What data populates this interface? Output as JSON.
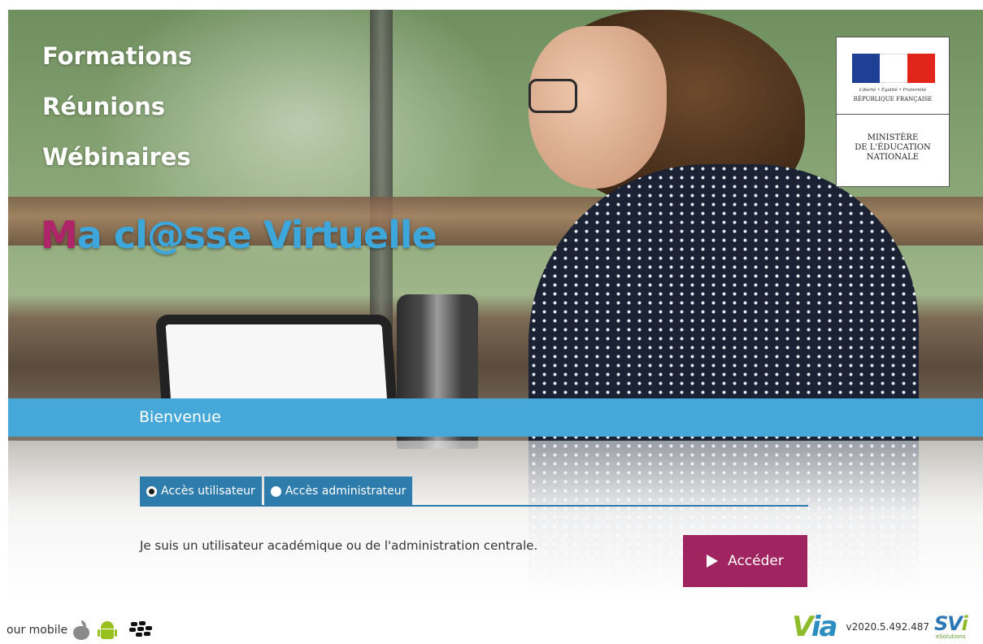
{
  "hero": {
    "taglines": [
      "Formations",
      "Réunions",
      "Wébinaires"
    ],
    "brand": {
      "part_m": "M",
      "part_rest": "a cl@sse Virtuelle",
      "color_m": "#b0246a",
      "color_rest": "#3da7db"
    },
    "ministry": {
      "motto": "Liberté • Égalité • Fraternité",
      "republic": "RÉPUBLIQUE FRANÇAISE",
      "line1": "MINISTÈRE",
      "line2": "DE L'ÉDUCATION",
      "line3": "NATIONALE"
    }
  },
  "welcome": {
    "title": "Bienvenue"
  },
  "tabs": [
    {
      "label": "Accès utilisateur",
      "selected": true
    },
    {
      "label": "Accès administrateur",
      "selected": false
    }
  ],
  "description": "Je suis un utilisateur académique ou de l'administration centrale.",
  "access_button": {
    "label": "Accéder"
  },
  "footer": {
    "mobile_text": "our mobile",
    "icons": [
      "apple-icon",
      "android-icon",
      "blackberry-icon"
    ],
    "via_logo": {
      "v": "V",
      "rest": "ia"
    },
    "version": "v2020.5.492.487",
    "svi_logo": {
      "text": "SV",
      "i": "i",
      "sub": "eSolutions"
    }
  },
  "colors": {
    "band": "#46a8d8",
    "tab": "#2e7cab",
    "button": "#a0245f"
  }
}
